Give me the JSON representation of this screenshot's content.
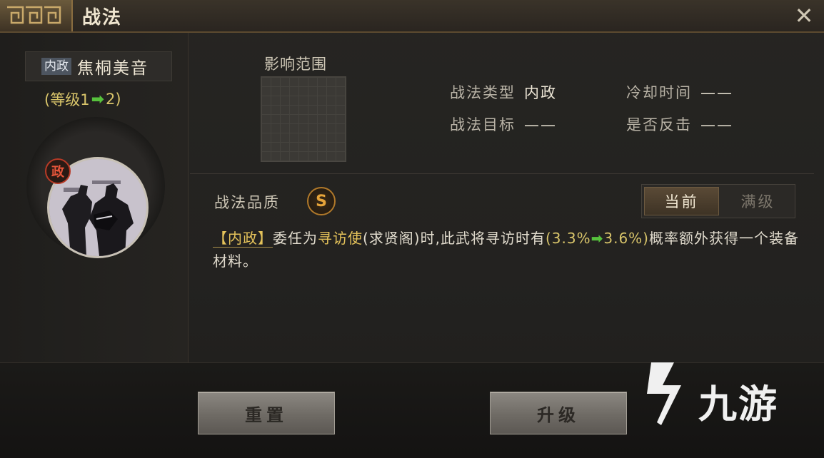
{
  "window": {
    "title": "战法"
  },
  "left": {
    "type_badge": "内政",
    "skill_name": "焦桐美音",
    "level_prefix": "(等级1",
    "level_arrow": "➡",
    "level_suffix": "2)",
    "gov_badge": "政"
  },
  "range": {
    "label": "影响范围"
  },
  "attributes": {
    "type_key": "战法类型",
    "type_val": "内政",
    "cooldown_key": "冷却时间",
    "cooldown_val": "——",
    "target_key": "战法目标",
    "target_val": "——",
    "counter_key": "是否反击",
    "counter_val": "——"
  },
  "quality": {
    "label": "战法品质",
    "grade": "S"
  },
  "toggle": {
    "current": "当前",
    "max": "满级",
    "selected": "current"
  },
  "description": {
    "tag": "【内政】",
    "p1": "委任为",
    "hl": "寻访使",
    "p2": "(求贤阁)时,此武将寻访时有",
    "paren_open": "(",
    "from": "3.3%",
    "arrow": "➡",
    "to": "3.6%",
    "paren_close": ")",
    "p3": "概率额外获得一个装备材料。"
  },
  "buttons": {
    "reset": "重置",
    "upgrade": "升级"
  },
  "watermark": {
    "text": "九游"
  },
  "colors": {
    "accent_gold": "#e4c25a",
    "arrow_green": "#56c13c",
    "grade_orange": "#e6a43a"
  }
}
